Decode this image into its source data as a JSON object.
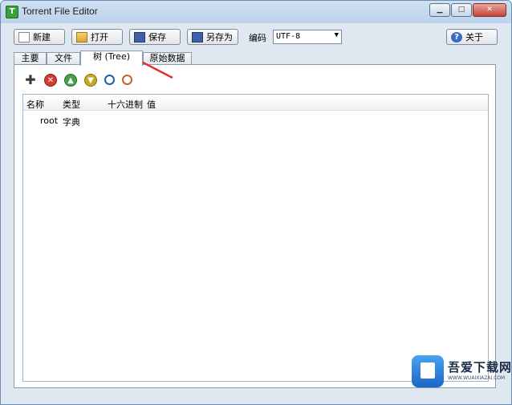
{
  "window": {
    "title": "Torrent File Editor",
    "app_icon_glyph": "T",
    "minimize_glyph": "▁",
    "maximize_glyph": "□",
    "close_glyph": "✕"
  },
  "toolbar": {
    "new_label": "新建",
    "open_label": "打开",
    "save_label": "保存",
    "saveas_label": "另存为",
    "encoding_label": "编码",
    "encoding_value": "UTF-8",
    "about_label": "关于"
  },
  "tabs": [
    {
      "label": "主要"
    },
    {
      "label": "文件"
    },
    {
      "label": "树 (Tree)"
    },
    {
      "label": "原始数据"
    }
  ],
  "active_tab": 2,
  "tree_toolbar": {
    "icons": [
      "add-icon",
      "delete-icon",
      "move-up-icon",
      "move-down-icon",
      "search-icon",
      "search-next-icon"
    ]
  },
  "tree": {
    "columns": [
      "名称",
      "类型",
      "十六进制",
      "值"
    ],
    "rows": [
      {
        "name": "root",
        "type": "字典",
        "hex": "",
        "value": ""
      }
    ]
  },
  "watermark": {
    "title": "吾爱下载网",
    "subtitle": "WWW.WUAIXIAZAI.COM"
  },
  "colors": {
    "annotation_arrow": "#e0322b"
  }
}
